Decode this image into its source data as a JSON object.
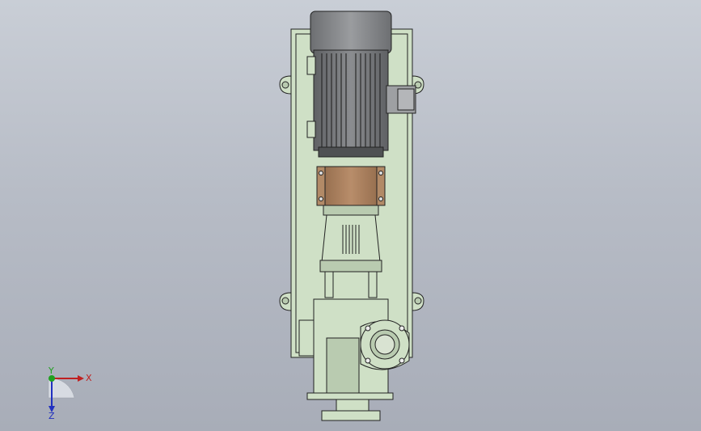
{
  "scene": {
    "background_top": "#c9ced6",
    "background_bottom": "#a8adb8",
    "body_color": "#cfe0c6",
    "body_shadow": "#9fb597",
    "motor_color": "#7f8184",
    "coupling_guard_color": "#a77c5b",
    "outline_color": "#222222"
  },
  "triad": {
    "x_label": "X",
    "y_label": "Y",
    "z_label": "Z",
    "x_color": "#c02020",
    "y_color": "#20a020",
    "z_color": "#2030c0"
  }
}
